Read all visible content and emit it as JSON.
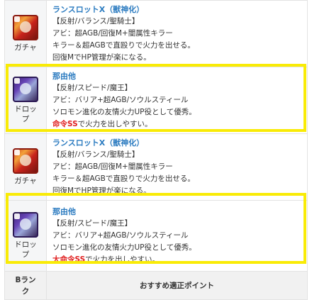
{
  "rows": [
    {
      "icon": "lancelot-x-avatar-icon",
      "caption": "ガチャ",
      "name": "ランスロットX（獣神化）",
      "line1": "【反射/バランス/聖騎士】",
      "line2": "アビ：超AGB/回復M+闇属性キラー",
      "line3": "キラー＆超AGBで直殴りで火力を出せる。",
      "line4": "回復MでHP管理が楽になる。"
    },
    {
      "icon": "nayuta-avatar-icon",
      "caption": "ドロップ",
      "name": "那由他",
      "line1": "【反射/スピード/魔王】",
      "line2": "アビ：バリア+超AGB/ソウルスティール",
      "line3": "ソロモン進化の友情火力UP役として優秀。",
      "line4_em": "命令SS",
      "line4_rest": "で火力を出しやすい。"
    },
    {
      "icon": "lancelot-x-avatar-icon",
      "caption": "ガチャ",
      "name": "ランスロットX（獣神化）",
      "line1": "【反射/バランス/聖騎士】",
      "line2": "アビ：超AGB/回復M+闇属性キラー",
      "line3": "キラー＆超AGBで直殴りで火力を出せる。",
      "line4": "回復MでHP管理が楽になる。"
    },
    {
      "icon": "nayuta-avatar-icon",
      "caption": "ドロップ",
      "name": "那由他",
      "line1": "【反射/スピード/魔王】",
      "line2": "アビ：バリア+超AGB/ソウルスティール",
      "line3": "ソロモン進化の友情火力UP役として優秀。",
      "line4_em": "大命令SS",
      "line4_rest": "で火力を出しやすい。"
    }
  ],
  "header": {
    "rank": "Bランク",
    "points": "おすすめ適正ポイント"
  },
  "colors": {
    "link": "#2b7bc0",
    "emphasis": "#e02121",
    "highlight": "#f9eb06",
    "border": "#e3e3e3",
    "left_bg": "#f5f6f7"
  }
}
